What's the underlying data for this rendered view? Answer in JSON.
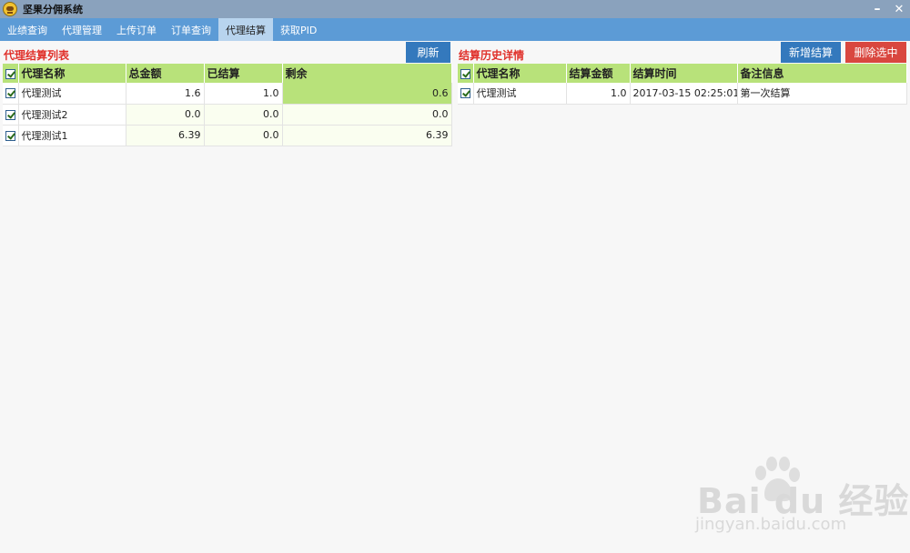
{
  "window": {
    "title": "坚果分佣系统",
    "minimize": "–",
    "close": "✕"
  },
  "tabs": [
    {
      "label": "业绩查询",
      "active": false
    },
    {
      "label": "代理管理",
      "active": false
    },
    {
      "label": "上传订单",
      "active": false
    },
    {
      "label": "订单查询",
      "active": false
    },
    {
      "label": "代理结算",
      "active": true
    },
    {
      "label": "获取PID",
      "active": false
    }
  ],
  "left_panel": {
    "title": "代理结算列表",
    "refresh_label": "刷新",
    "columns": [
      "代理名称",
      "总金额",
      "已结算",
      "剩余"
    ],
    "rows": [
      {
        "name": "代理测试",
        "total": "1.6",
        "settled": "1.0",
        "remaining": "0.6"
      },
      {
        "name": "代理测试2",
        "total": "0.0",
        "settled": "0.0",
        "remaining": "0.0"
      },
      {
        "name": "代理测试1",
        "total": "6.39",
        "settled": "0.0",
        "remaining": "6.39"
      }
    ]
  },
  "right_panel": {
    "title": "结算历史详情",
    "new_label": "新增结算",
    "delete_label": "删除选中",
    "columns": [
      "代理名称",
      "结算金额",
      "结算时间",
      "备注信息"
    ],
    "rows": [
      {
        "name": "代理测试",
        "amount": "1.0",
        "time": "2017-03-15 02:25:01",
        "note": "第一次结算"
      }
    ]
  },
  "watermark": {
    "brand": "Bai du 经验",
    "url": "jingyan.baidu.com"
  },
  "colors": {
    "accent": "#5c9bd6",
    "header_green": "#b8e27a",
    "title_red": "#e0302a",
    "danger": "#d9473f"
  }
}
